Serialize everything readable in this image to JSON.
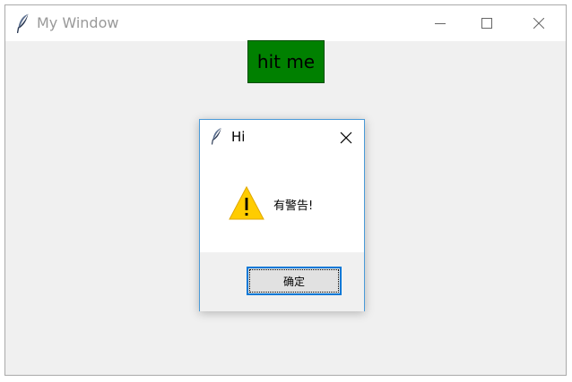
{
  "window": {
    "title": "My Window",
    "icon": "feather-icon",
    "controls": [
      "minimize-icon",
      "maximize-icon",
      "close-icon"
    ]
  },
  "main": {
    "button_label": "hit me",
    "button_color": "#008000"
  },
  "dialog": {
    "title": "Hi",
    "icon": "feather-icon",
    "message_icon": "warning-icon",
    "message": "有警告!",
    "ok_label": "确定",
    "focus_color": "#0078d7"
  }
}
